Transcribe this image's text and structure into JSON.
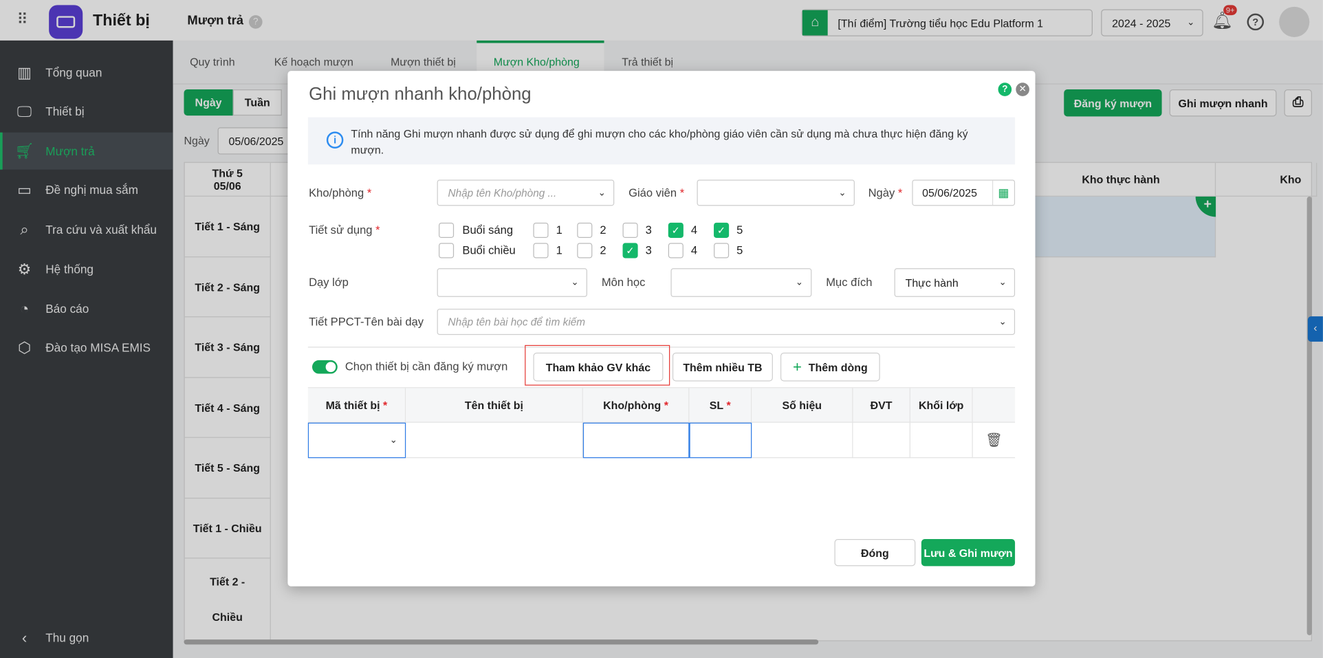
{
  "header": {
    "app_title": "Thiết bị",
    "page_title": "Mượn trả",
    "school": "[Thí điểm] Trường tiểu học Edu Platform 1",
    "year": "2024 - 2025",
    "notif_badge": "9+"
  },
  "sidebar": {
    "items": [
      {
        "label": "Tổng quan",
        "icon": "chart-icon"
      },
      {
        "label": "Thiết bị",
        "icon": "monitor-icon"
      },
      {
        "label": "Mượn trả",
        "icon": "cart-icon",
        "active": true
      },
      {
        "label": "Đề nghị mua sắm",
        "icon": "projector-icon"
      },
      {
        "label": "Tra cứu và xuất khẩu",
        "icon": "search-icon"
      },
      {
        "label": "Hệ thống",
        "icon": "gear-icon"
      },
      {
        "label": "Báo cáo",
        "icon": "pie-icon"
      },
      {
        "label": "Đào tạo MISA EMIS",
        "icon": "cube-icon"
      }
    ],
    "collapse": "Thu gọn"
  },
  "tabs": [
    "Quy trình",
    "Kế hoạch mượn",
    "Mượn thiết bị",
    "Mượn Kho/phòng",
    "Trả thiết bị"
  ],
  "toolbar": {
    "view_day": "Ngày",
    "view_week": "Tuần",
    "date_label": "Ngày",
    "date_value": "05/06/2025",
    "register": "Đăng ký mượn",
    "quick": "Ghi mượn nhanh"
  },
  "schedule": {
    "day_header": [
      "Thứ 5",
      "05/06"
    ],
    "rooms": [
      "",
      "",
      "",
      "",
      "Kho thực hành",
      "Kho"
    ],
    "periods": [
      "Tiết 1 - Sáng",
      "Tiết 2 - Sáng",
      "Tiết 3 - Sáng",
      "Tiết 4 - Sáng",
      "Tiết 5 - Sáng",
      "Tiết 1 - Chiều",
      "Tiết 2 - Chiều"
    ]
  },
  "modal": {
    "title": "Ghi mượn nhanh kho/phòng",
    "info": "Tính năng Ghi mượn nhanh được sử dụng để ghi mượn cho các kho/phòng giáo viên cần sử dụng mà chưa thực hiện đăng ký mượn.",
    "room_label": "Kho/phòng",
    "room_placeholder": "Nhập tên Kho/phòng ...",
    "teacher_label": "Giáo viên",
    "date_label": "Ngày",
    "date_value": "05/06/2025",
    "period_label": "Tiết sử dụng",
    "morning": {
      "label": "Buổi sáng",
      "checked": false,
      "periods": [
        {
          "n": "1",
          "checked": false
        },
        {
          "n": "2",
          "checked": false
        },
        {
          "n": "3",
          "checked": false
        },
        {
          "n": "4",
          "checked": true
        },
        {
          "n": "5",
          "checked": true
        }
      ]
    },
    "afternoon": {
      "label": "Buổi chiều",
      "checked": false,
      "periods": [
        {
          "n": "1",
          "checked": false
        },
        {
          "n": "2",
          "checked": false
        },
        {
          "n": "3",
          "checked": true
        },
        {
          "n": "4",
          "checked": false
        },
        {
          "n": "5",
          "checked": false
        }
      ]
    },
    "class_label": "Dạy lớp",
    "subject_label": "Môn học",
    "purpose_label": "Mục đích",
    "purpose_value": "Thực hành",
    "lesson_label": "Tiết PPCT-Tên bài dạy",
    "lesson_placeholder": "Nhập tên bài học để tìm kiếm",
    "toggle_label": "Chọn thiết bị cần đăng ký mượn",
    "toggle_on": true,
    "ref_btn": "Tham khảo GV khác",
    "multi_btn": "Thêm nhiều TB",
    "add_row_btn": "Thêm dòng",
    "columns": [
      "Mã thiết bị",
      "Tên thiết bị",
      "Kho/phòng",
      "SL",
      "Số hiệu",
      "ĐVT",
      "Khối lớp"
    ],
    "close_btn": "Đóng",
    "save_btn": "Lưu & Ghi mượn"
  },
  "colors": {
    "accent": "#14a85a",
    "required": "#e0262b",
    "highlight": "#e53935"
  }
}
